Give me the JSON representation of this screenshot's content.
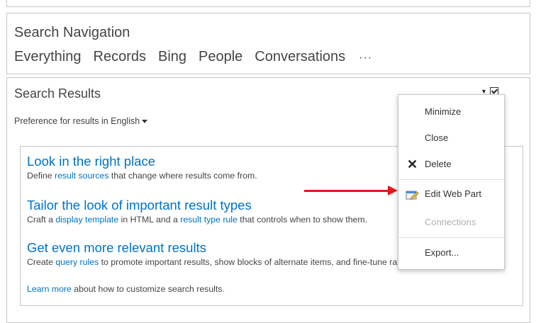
{
  "search_navigation": {
    "title": "Search Navigation",
    "links": [
      "Everything",
      "Records",
      "Bing",
      "People",
      "Conversations"
    ],
    "more": "···"
  },
  "search_results": {
    "title": "Search Results",
    "preference_prefix": "Preference for results in ",
    "language": "English",
    "tips": [
      {
        "title": "Look in the right place",
        "pre": "Define ",
        "link": "result sources",
        "post": " that change where results come from."
      },
      {
        "title": "Tailor the look of important result types",
        "pre": "Craft a ",
        "link": "display template",
        "mid": " in HTML and a ",
        "link2": "result type rule",
        "post": " that controls when to show them."
      },
      {
        "title": "Get even more relevant results",
        "pre": "Create ",
        "link": "query rules",
        "post": " to promote important results, show blocks of alternate items, and fine-tune ranking."
      }
    ],
    "learn_more_link": "Learn more",
    "learn_more_text": " about how to customize search results."
  },
  "context_menu": {
    "items": [
      {
        "label": "Minimize",
        "icon": null,
        "enabled": true
      },
      {
        "label": "Close",
        "icon": null,
        "enabled": true
      },
      {
        "label": "Delete",
        "icon": "x-icon",
        "enabled": true
      },
      {
        "label": "Edit Web Part",
        "icon": "edit-webpart-icon",
        "enabled": true
      },
      {
        "label": "Connections",
        "icon": null,
        "enabled": false
      },
      {
        "label": "Export...",
        "icon": null,
        "enabled": true
      }
    ]
  },
  "colors": {
    "link": "#0072c6",
    "text": "#444444",
    "border": "#c6c6c6",
    "annotation_arrow": "#e8141c",
    "disabled": "#b1b1b1"
  }
}
